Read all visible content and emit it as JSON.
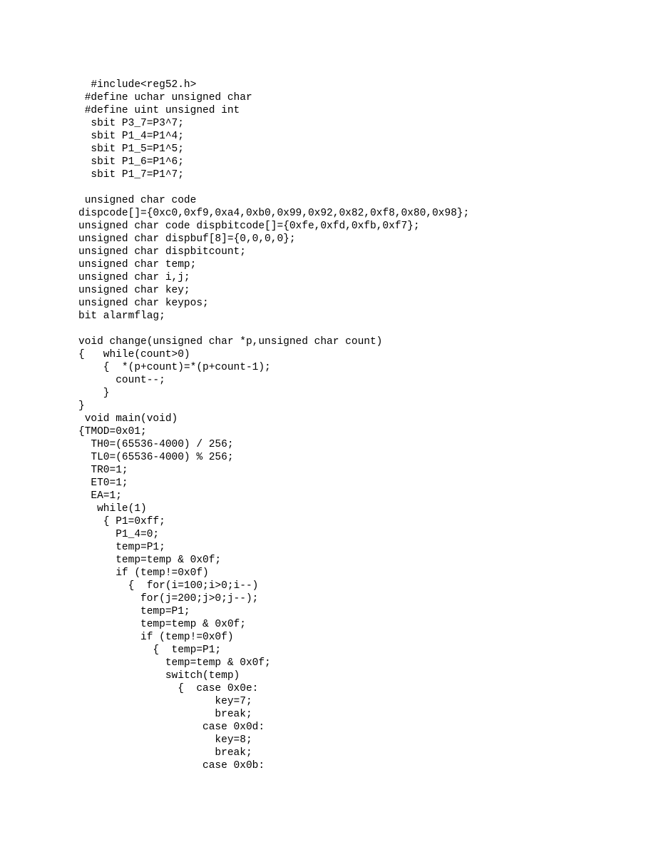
{
  "code": {
    "lines": [
      "  #include<reg52.h>",
      " #define uchar unsigned char",
      " #define uint unsigned int",
      "  sbit P3_7=P3^7;",
      "  sbit P1_4=P1^4;",
      "  sbit P1_5=P1^5;",
      "  sbit P1_6=P1^6;",
      "  sbit P1_7=P1^7;",
      "",
      " unsigned char code",
      "dispcode[]={0xc0,0xf9,0xa4,0xb0,0x99,0x92,0x82,0xf8,0x80,0x98};",
      "unsigned char code dispbitcode[]={0xfe,0xfd,0xfb,0xf7};",
      "unsigned char dispbuf[8]={0,0,0,0};",
      "unsigned char dispbitcount;",
      "unsigned char temp;",
      "unsigned char i,j;",
      "unsigned char key;",
      "unsigned char keypos;",
      "bit alarmflag;",
      "",
      "void change(unsigned char *p,unsigned char count)",
      "{   while(count>0)",
      "    {  *(p+count)=*(p+count-1);",
      "      count--;",
      "    }",
      "}",
      " void main(void)",
      "{TMOD=0x01;",
      "  TH0=(65536-4000) / 256;",
      "  TL0=(65536-4000) % 256;",
      "  TR0=1;",
      "  ET0=1;",
      "  EA=1;",
      "   while(1)",
      "    { P1=0xff;",
      "      P1_4=0;",
      "      temp=P1;",
      "      temp=temp & 0x0f;",
      "      if (temp!=0x0f)",
      "        {  for(i=100;i>0;i--)",
      "          for(j=200;j>0;j--);",
      "          temp=P1;",
      "          temp=temp & 0x0f;",
      "          if (temp!=0x0f)",
      "            {  temp=P1;",
      "              temp=temp & 0x0f;",
      "              switch(temp)",
      "                {  case 0x0e:",
      "                      key=7;",
      "                      break;",
      "                    case 0x0d:",
      "                      key=8;",
      "                      break;",
      "                    case 0x0b:"
    ]
  }
}
